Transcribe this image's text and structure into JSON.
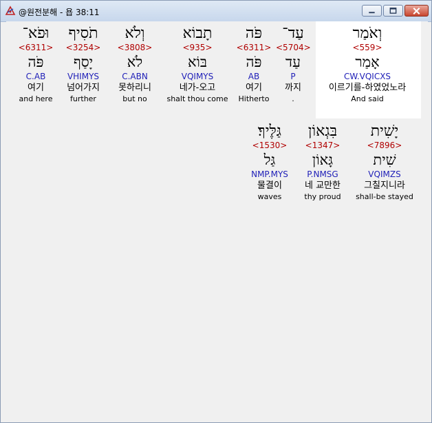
{
  "window": {
    "title": "@원전분해 - 욥 38:11"
  },
  "rows": [
    [
      {
        "heb": "וְאֹמַר",
        "strong": "<559>",
        "lemma": "אָמַר",
        "morph": "CW.VQICXS",
        "kor": "이르기를-하였었노라",
        "eng": "And said"
      },
      {
        "heb": "עַד־",
        "strong": "<5704>",
        "lemma": "עַד",
        "morph": "P",
        "kor": "까지",
        "eng": "."
      },
      {
        "heb": "פֹּה",
        "strong": "<6311>",
        "lemma": "פֹּה",
        "morph": "AB",
        "kor": "여기",
        "eng": "Hitherto"
      },
      {
        "heb": "תָבוֹא",
        "strong": "<935>",
        "lemma": "בּוֹא",
        "morph": "VQIMYS",
        "kor": "네가-오고",
        "eng": "shalt thou come"
      },
      {
        "heb": "וְלֹא",
        "strong": "<3808>",
        "lemma": "לֹא",
        "morph": "C.ABN",
        "kor": "못하리니",
        "eng": "but no"
      },
      {
        "heb": "תֹסִיף",
        "strong": "<3254>",
        "lemma": "יָסַף",
        "morph": "VHIMYS",
        "kor": "넘어가지",
        "eng": "further"
      },
      {
        "heb": "וּפֹא־",
        "strong": "<6311>",
        "lemma": "פֹּה",
        "morph": "C.AB",
        "kor": "여기",
        "eng": "and here"
      }
    ],
    [
      {
        "heb": "יָשִׁית",
        "strong": "<7896>",
        "lemma": "שִׁית",
        "morph": "VQIMZS",
        "kor": "그칠지니라",
        "eng": "shall-be stayed"
      },
      {
        "heb": "בִּגְאוֹן",
        "strong": "<1347>",
        "lemma": "גָּאוֹן",
        "morph": "P.NMSG",
        "kor": "네 교만한",
        "eng": "thy proud"
      },
      {
        "heb": "גַּלֶּיךָ׃",
        "strong": "<1530>",
        "lemma": "גַּל",
        "morph": "NMP.MYS",
        "kor": "물결이",
        "eng": "waves"
      }
    ]
  ]
}
